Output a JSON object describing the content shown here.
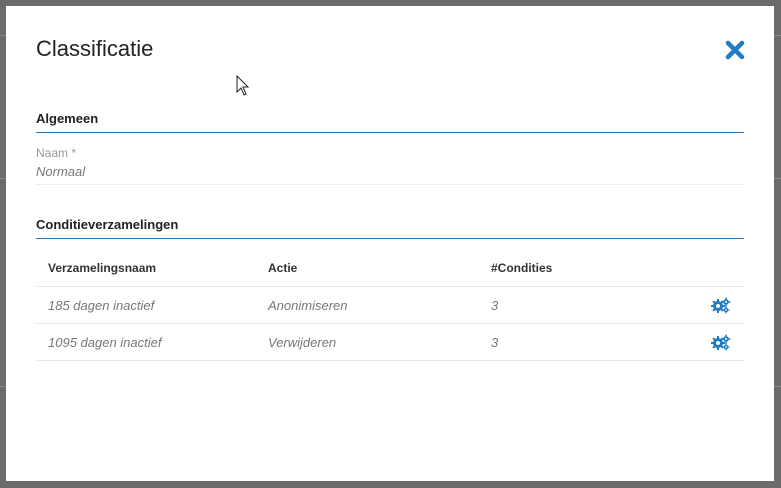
{
  "dialog": {
    "title": "Classificatie",
    "close_icon": "close-icon",
    "accent_color": "#1e7bc4"
  },
  "general": {
    "section_title": "Algemeen",
    "name_label": "Naam *",
    "name_value": "Normaal"
  },
  "conditions": {
    "section_title": "Conditieverzamelingen",
    "columns": [
      "Verzamelingsnaam",
      "Actie",
      "#Condities"
    ],
    "rows": [
      {
        "name": "185 dagen inactief",
        "action": "Anonimiseren",
        "count": "3",
        "icon": "gears-icon"
      },
      {
        "name": "1095 dagen inactief",
        "action": "Verwijderen",
        "count": "3",
        "icon": "gears-icon"
      }
    ]
  }
}
